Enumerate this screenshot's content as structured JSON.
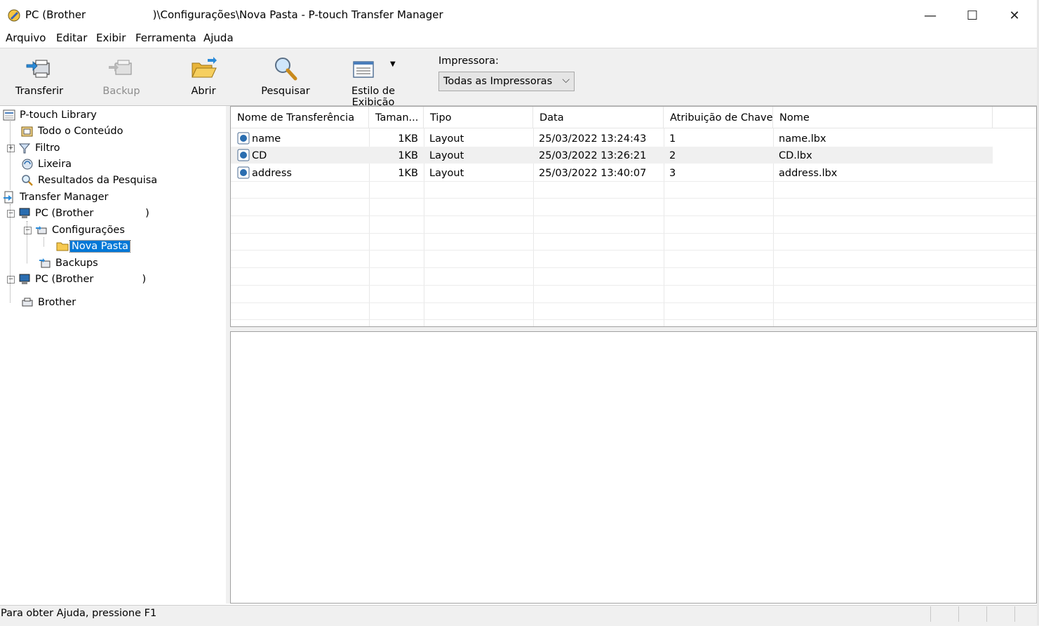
{
  "window": {
    "title": "PC (Brother                    )\\Configurações\\Nova Pasta - P-touch Transfer Manager",
    "minimize": "—",
    "maximize": "☐",
    "close": "✕"
  },
  "menu": [
    "Arquivo",
    "Editar",
    "Exibir",
    "Ferramenta",
    "Ajuda"
  ],
  "toolbar": {
    "transferir": "Transferir",
    "backup": "Backup",
    "abrir": "Abrir",
    "pesquisar": "Pesquisar",
    "estilo": "Estilo de Exibição",
    "printer_label": "Impressora:",
    "printer_value": "Todas as Impressoras"
  },
  "tree": {
    "library": "P-touch Library",
    "todo": "Todo o Conteúdo",
    "filtro": "Filtro",
    "lixeira": "Lixeira",
    "resultados": "Resultados da Pesquisa",
    "transfer_manager": "Transfer Manager",
    "pc1": "PC (Brother                )",
    "configuracoes": "Configurações",
    "nova_pasta": "Nova Pasta",
    "backups": "Backups",
    "pc2": "PC (Brother               )",
    "brother": "Brother"
  },
  "list": {
    "columns": [
      "Nome de Transferência",
      "Taman...",
      "Tipo",
      "Data",
      "Atribuição de Chave",
      "Nome"
    ],
    "rows": [
      {
        "name": "name",
        "size": "1KB",
        "type": "Layout",
        "date": "25/03/2022 13:24:43",
        "key": "1",
        "file": "name.lbx"
      },
      {
        "name": "CD",
        "size": "1KB",
        "type": "Layout",
        "date": "25/03/2022 13:26:21",
        "key": "2",
        "file": "CD.lbx"
      },
      {
        "name": "address",
        "size": "1KB",
        "type": "Layout",
        "date": "25/03/2022 13:40:07",
        "key": "3",
        "file": "address.lbx"
      }
    ]
  },
  "status": {
    "text": "Para obter Ajuda, pressione F1"
  },
  "colors": {
    "selection": "#0078d7",
    "toolbar_bg": "#f0f0f0"
  }
}
